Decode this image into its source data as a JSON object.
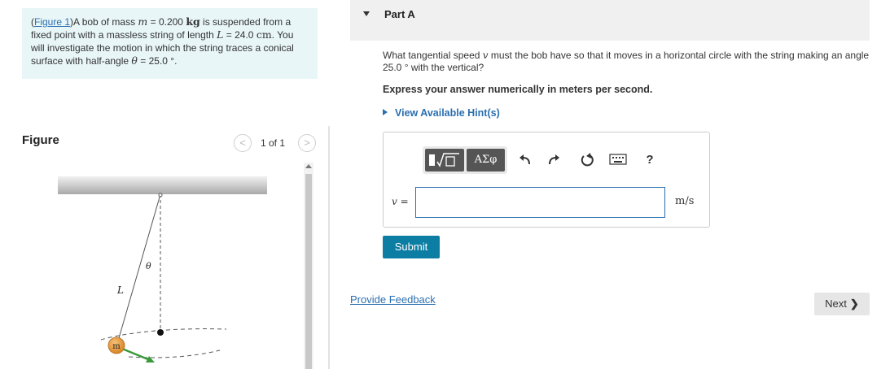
{
  "problem": {
    "figure_link": "Figure 1",
    "t_a": ")A bob of mass ",
    "m_sym": "m",
    "t_b": " = 0.200 ",
    "kg": "kg",
    "t_c": " is suspended from a fixed point with a massless string of length ",
    "L_sym": "L",
    "t_d": " = 24.0 ",
    "cm": "cm",
    "t_e": ". You will investigate the motion in which the string traces a conical surface with half-angle ",
    "theta_sym": "θ",
    "t_f": " = 25.0 °."
  },
  "figure_panel": {
    "title": "Figure",
    "counter": "1 of 1",
    "prev_icon": "<",
    "next_icon": ">",
    "labels": {
      "theta": "θ",
      "L": "L",
      "m": "m"
    }
  },
  "part_a": {
    "title": "Part A",
    "q_a": "What tangential speed ",
    "q_v": "v",
    "q_b": " must the bob have so that it moves in a horizontal circle with the string making an angle 25.0 ° with the vertical?",
    "instruction": "Express your answer numerically in meters per second.",
    "hint_link": "View Available Hint(s)"
  },
  "answer": {
    "var_label": "v =",
    "value": "",
    "unit": "m/s",
    "greek_button": "ΑΣφ",
    "help_button": "?"
  },
  "actions": {
    "submit": "Submit",
    "feedback": "Provide Feedback",
    "next": "Next",
    "next_icon": "❯"
  },
  "colors": {
    "problem_bg": "#e8f6f8",
    "link": "#2a6fb0",
    "submit_bg": "#0d7ea3",
    "velocity_arrow": "#3a9a3a",
    "bob": "#e8952e"
  }
}
